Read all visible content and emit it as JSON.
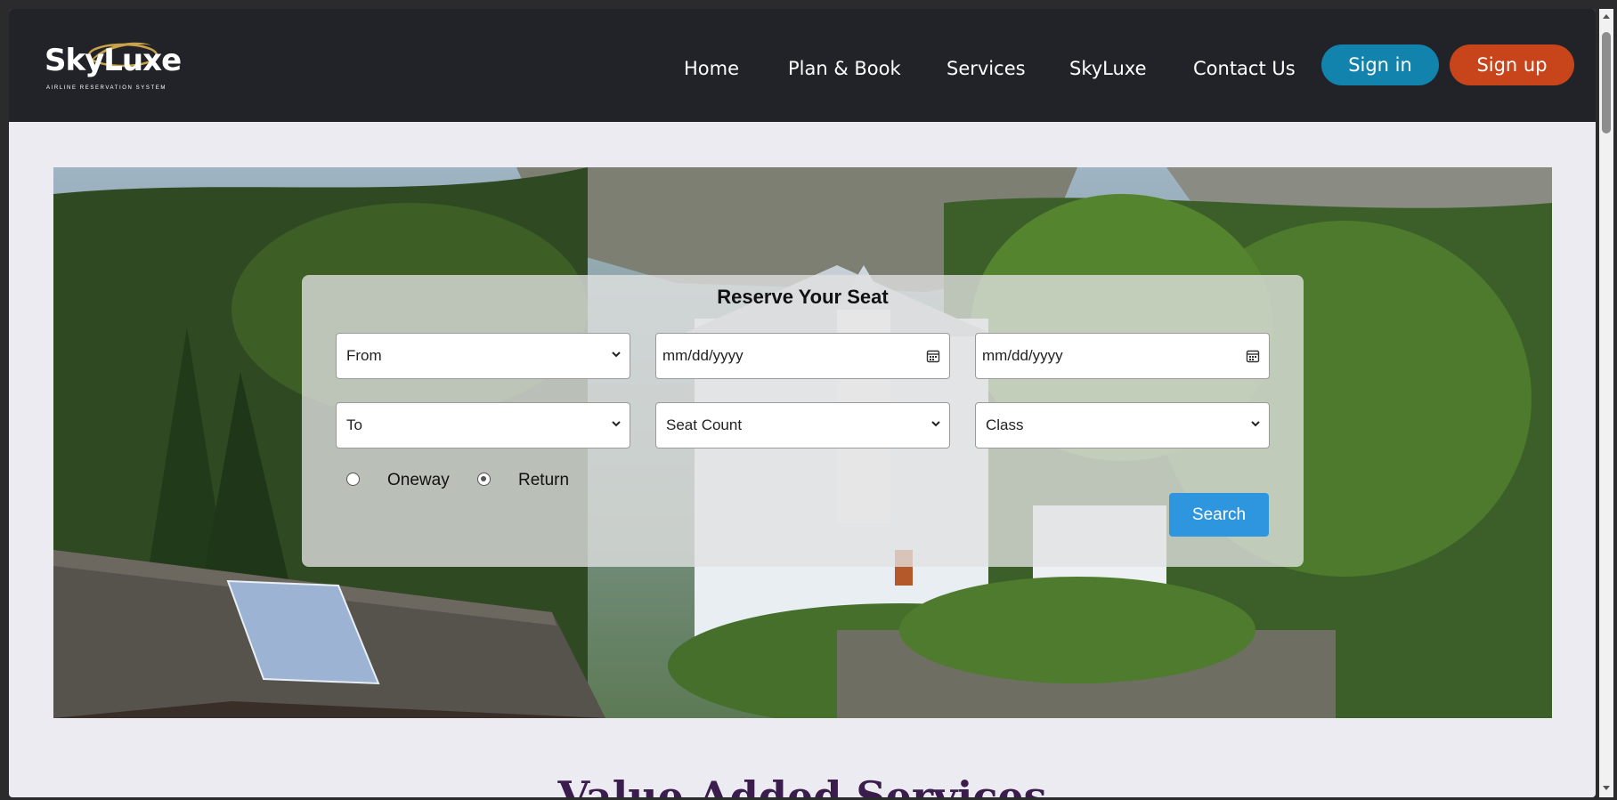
{
  "brand": {
    "name": "SkyLuxe",
    "tagline": "AIRLINE RESERVATION SYSTEM"
  },
  "nav": {
    "links": [
      "Home",
      "Plan & Book",
      "Services",
      "SkyLuxe",
      "Contact Us"
    ],
    "signin_label": "Sign in",
    "signup_label": "Sign up"
  },
  "booking": {
    "title": "Reserve Your Seat",
    "from_select": "From",
    "to_select": "To",
    "depart_date_placeholder": "mm/dd/yyyy",
    "return_date_placeholder": "mm/dd/yyyy",
    "seat_count_select": "Seat Count",
    "class_select": "Class",
    "trip_types": [
      {
        "label": "Oneway",
        "checked": false
      },
      {
        "label": "Return",
        "checked": true
      }
    ],
    "search_label": "Search"
  },
  "section": {
    "title": "Value Added Services"
  },
  "colors": {
    "navbar": "#222329",
    "signin": "#1283ac",
    "signup": "#c8441a",
    "search": "#2e96de",
    "section_title": "#3b1d4d"
  }
}
